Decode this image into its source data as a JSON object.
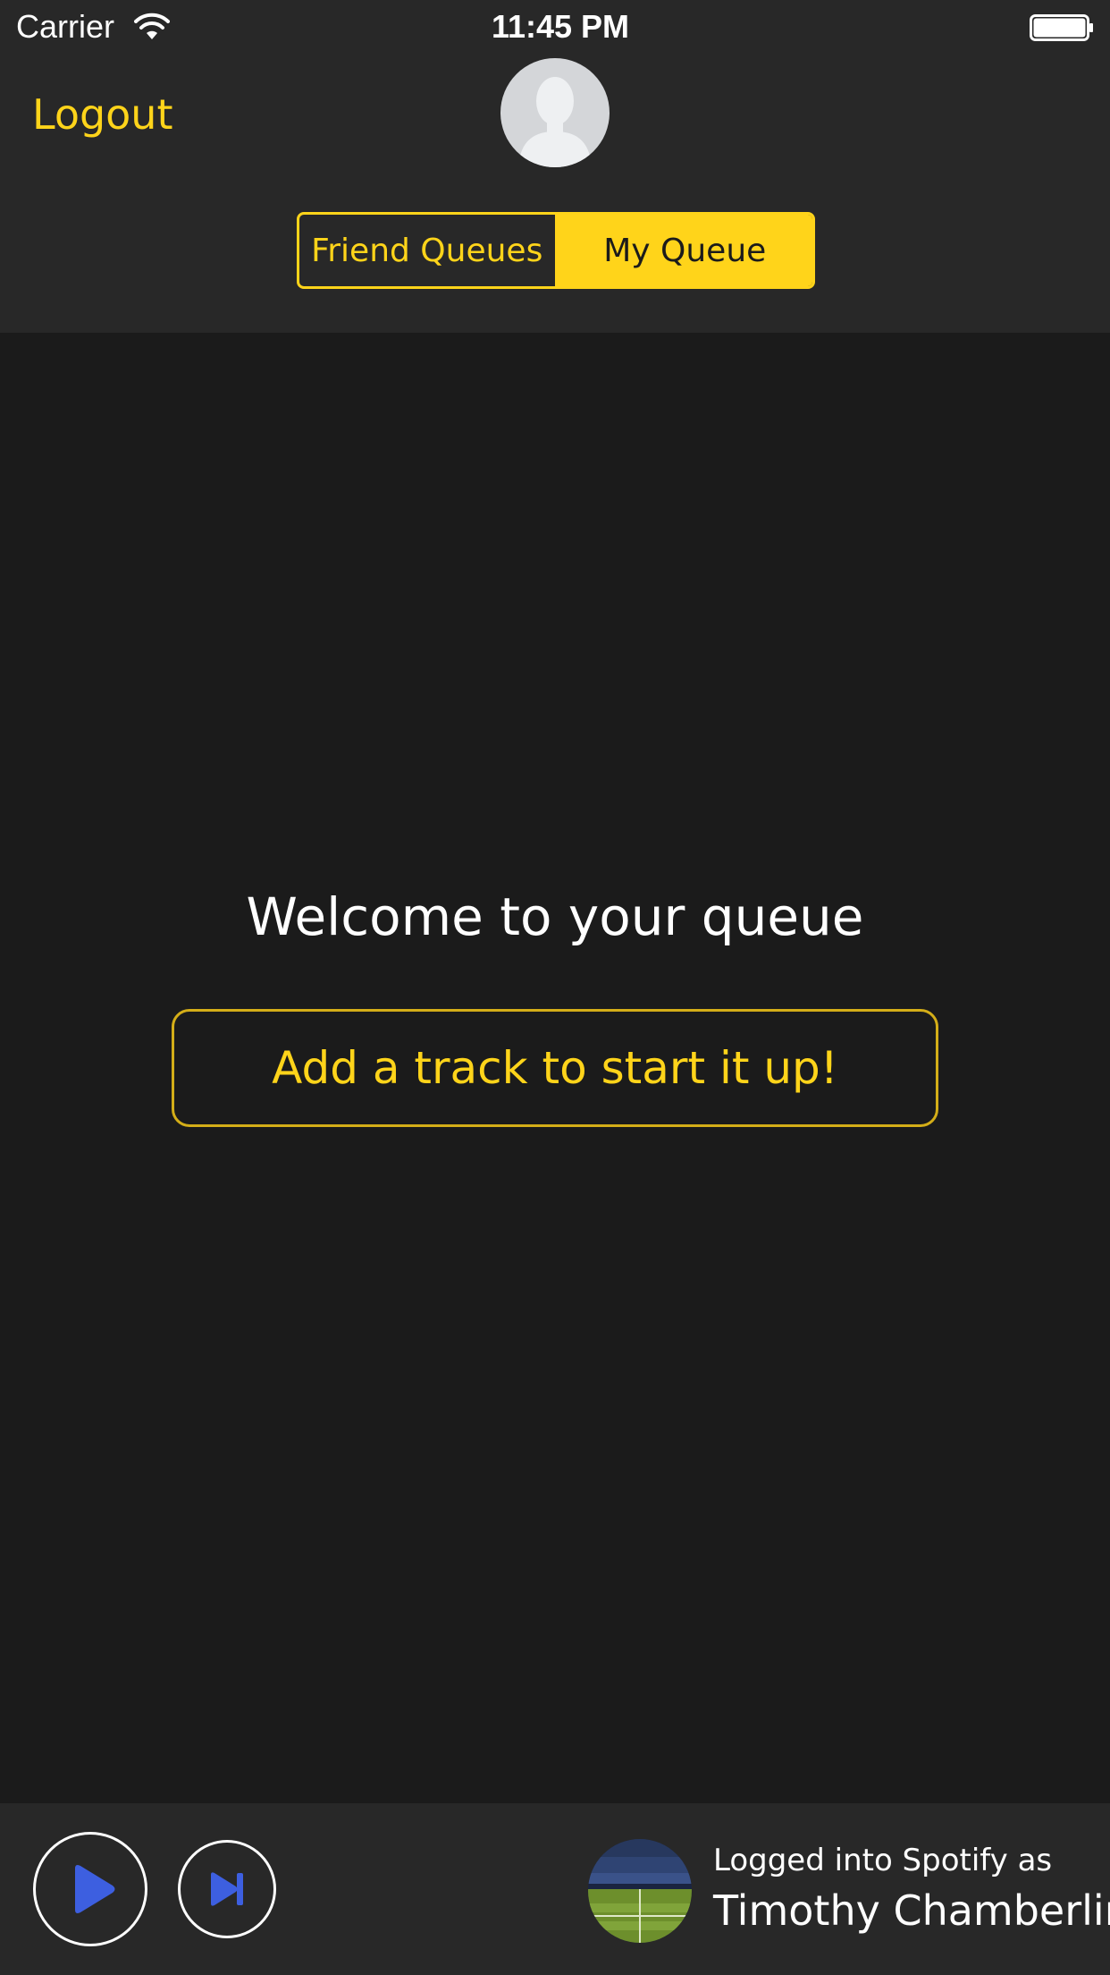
{
  "status_bar": {
    "carrier": "Carrier",
    "time": "11:45 PM"
  },
  "header": {
    "logout_label": "Logout",
    "segments": [
      {
        "label": "Friend Queues",
        "selected": false
      },
      {
        "label": "My Queue",
        "selected": true
      }
    ]
  },
  "main": {
    "welcome_text": "Welcome to your queue",
    "add_track_label": "Add a track to start it up!"
  },
  "footer": {
    "login_caption": "Logged into Spotify as",
    "user_name": "Timothy Chamberlin"
  },
  "icons": {
    "play": "play-icon",
    "skip": "skip-forward-icon",
    "wifi": "wifi-icon",
    "battery": "battery-icon",
    "avatar": "person-silhouette-icon"
  },
  "colors": {
    "accent": "#ffd41a",
    "header_bg": "#282828",
    "main_bg": "#1b1b1b",
    "icon_blue": "#3d5fe0"
  }
}
